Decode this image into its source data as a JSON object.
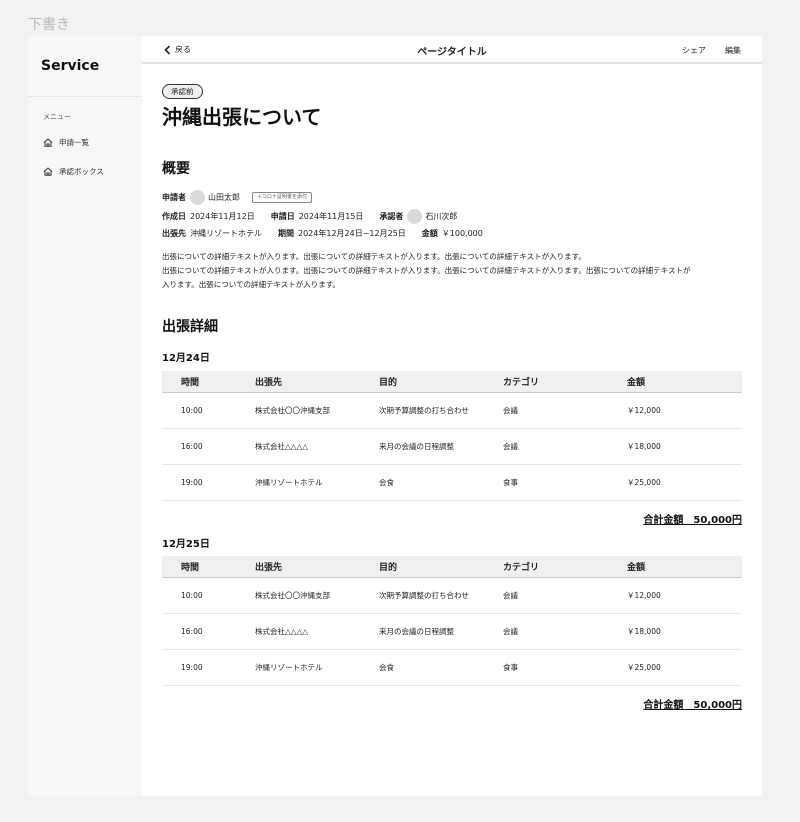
{
  "draft_label": "下書き",
  "sidebar": {
    "brand": "Service",
    "menu_heading": "メニュー",
    "items": [
      {
        "label": "申請一覧",
        "icon": "home-icon"
      },
      {
        "label": "承認ボックス",
        "icon": "home-icon"
      }
    ]
  },
  "topbar": {
    "back_label": "戻る",
    "title": "ページタイトル",
    "share_label": "シェア",
    "edit_label": "編集"
  },
  "status_badge": "承認前",
  "heading": "沖縄出張について",
  "overview": {
    "title": "概要",
    "applicant_label": "申請者",
    "applicant": "山田太郎",
    "attach_button": "＋コロナ証明書を添付",
    "created_label": "作成日",
    "created": "2024年11月12日",
    "applied_label": "申請日",
    "applied": "2024年11月15日",
    "approver_label": "承認者",
    "approver": "石川次郎",
    "destination_label": "出張先",
    "destination": "沖縄リゾートホテル",
    "period_label": "期間",
    "period": "2024年12月24日~12月25日",
    "amount_label": "金額",
    "amount": "￥100,000",
    "description": [
      "出張についての詳細テキストが入ります。出張についての詳細テキストが入ります。出張についての詳細テキストが入ります。",
      "出張についての詳細テキストが入ります。出張についての詳細テキストが入ります。出張についての詳細テキストが入ります。出張についての詳細テキストが",
      "入ります。出張についての詳細テキストが入ります。"
    ]
  },
  "details": {
    "title": "出張詳細",
    "columns": [
      "時間",
      "出張先",
      "目的",
      "カテゴリ",
      "金額"
    ],
    "days": [
      {
        "date": "12月24日",
        "rows": [
          [
            "10:00",
            "株式会社〇〇沖縄支部",
            "次期予算調整の打ち合わせ",
            "会議",
            "￥12,000"
          ],
          [
            "16:00",
            "株式会社△△△△",
            "来月の会議の日程調整",
            "会議",
            "￥18,000"
          ],
          [
            "19:00",
            "沖縄リゾートホテル",
            "会食",
            "食事",
            "￥25,000"
          ]
        ],
        "total": "合計金額　50,000円"
      },
      {
        "date": "12月25日",
        "rows": [
          [
            "10:00",
            "株式会社〇〇沖縄支部",
            "次期予算調整の打ち合わせ",
            "会議",
            "￥12,000"
          ],
          [
            "16:00",
            "株式会社△△△△",
            "来月の会議の日程調整",
            "会議",
            "￥18,000"
          ],
          [
            "19:00",
            "沖縄リゾートホテル",
            "会食",
            "食事",
            "￥25,000"
          ]
        ],
        "total": "合計金額　50,000円"
      }
    ]
  }
}
